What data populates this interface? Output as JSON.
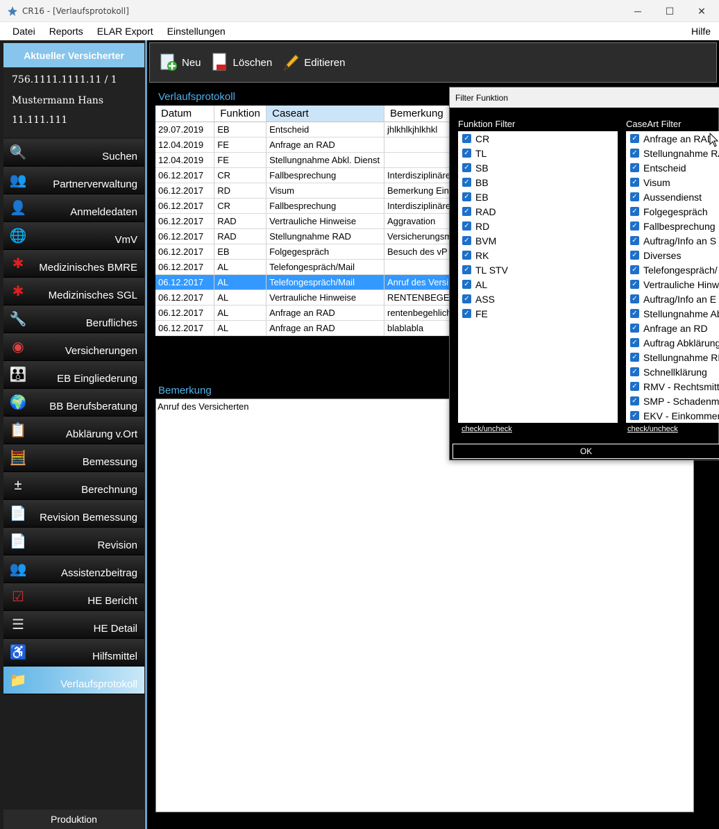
{
  "window": {
    "title": "CR16 - [Verlaufsprotokoll]",
    "minimize_glyph": "─",
    "maximize_glyph": "☐",
    "close_glyph": "✕"
  },
  "menu": {
    "items": [
      "Datei",
      "Reports",
      "ELAR Export",
      "Einstellungen"
    ],
    "help": "Hilfe"
  },
  "insured": {
    "header": "Aktueller Versicherter",
    "number": "756.1111.1111.11 / 1",
    "name": "Mustermann Hans",
    "code": "11.111.111"
  },
  "nav": {
    "items": [
      {
        "label": "Suchen",
        "icon": "search-person-icon"
      },
      {
        "label": "Partnerverwaltung",
        "icon": "people-icon"
      },
      {
        "label": "Anmeldedaten",
        "icon": "user-icon"
      },
      {
        "label": "VmV",
        "icon": "globe-icon"
      },
      {
        "label": "Medizinisches BMRE",
        "icon": "medical-star-icon"
      },
      {
        "label": "Medizinisches SGL",
        "icon": "medical-star-icon"
      },
      {
        "label": "Berufliches",
        "icon": "tools-icon"
      },
      {
        "label": "Versicherungen",
        "icon": "lifebuoy-icon"
      },
      {
        "label": "EB Eingliederung",
        "icon": "group-icon"
      },
      {
        "label": "BB Berufsberatung",
        "icon": "globe-people-icon"
      },
      {
        "label": "Abklärung v.Ort",
        "icon": "clipboard-icon"
      },
      {
        "label": "Bemessung",
        "icon": "calculator-icon"
      },
      {
        "label": "Berechnung",
        "icon": "math-icon"
      },
      {
        "label": "Revision Bemessung",
        "icon": "document-chart-icon"
      },
      {
        "label": "Revision",
        "icon": "document-chart-icon"
      },
      {
        "label": "Assistenzbeitrag",
        "icon": "people-icon"
      },
      {
        "label": "HE Bericht",
        "icon": "report-check-icon"
      },
      {
        "label": "HE Detail",
        "icon": "report-list-icon"
      },
      {
        "label": "Hilfsmittel",
        "icon": "wheelchair-icon"
      },
      {
        "label": "Verlaufsprotokoll",
        "icon": "folder-icon"
      }
    ],
    "active": "Verlaufsprotokoll",
    "footer": "Produktion"
  },
  "toolbar": {
    "new_label": "Neu",
    "delete_label": "Löschen",
    "edit_label": "Editieren"
  },
  "protocol": {
    "title": "Verlaufsprotokoll",
    "columns": [
      "Datum",
      "Funktion",
      "Caseart",
      "Bemerkung"
    ],
    "sorted_column": "Caseart",
    "rows": [
      [
        "29.07.2019",
        "EB",
        "Entscheid",
        "jhlkhlkjhlkhkl"
      ],
      [
        "12.04.2019",
        "FE",
        "Anfrage an RAD",
        ""
      ],
      [
        "12.04.2019",
        "FE",
        "Stellungnahme Abkl. Dienst",
        ""
      ],
      [
        "06.12.2017",
        "CR",
        "Fallbesprechung",
        "Interdisziplinäre"
      ],
      [
        "06.12.2017",
        "RD",
        "Visum",
        "Bemerkung Ein"
      ],
      [
        "06.12.2017",
        "CR",
        "Fallbesprechung",
        "Interdisziplinäre"
      ],
      [
        "06.12.2017",
        "RAD",
        "Vertrauliche Hinweise",
        "Aggravation"
      ],
      [
        "06.12.2017",
        "RAD",
        "Stellungnahme RAD",
        "Versicherungsm"
      ],
      [
        "06.12.2017",
        "EB",
        "Folgegespräch",
        "Besuch des vP"
      ],
      [
        "06.12.2017",
        "AL",
        "Telefongespräch/Mail",
        ""
      ],
      [
        "06.12.2017",
        "AL",
        "Telefongespräch/Mail",
        "Anruf des Versi"
      ],
      [
        "06.12.2017",
        "AL",
        "Vertrauliche Hinweise",
        "RENTENBEGE"
      ],
      [
        "06.12.2017",
        "AL",
        "Anfrage an RAD",
        "rentenbegehlich"
      ],
      [
        "06.12.2017",
        "AL",
        "Anfrage an RAD",
        "blablabla"
      ]
    ],
    "selected_row": 10
  },
  "remark": {
    "title": "Bemerkung",
    "text": "Anruf des Versicherten"
  },
  "filter_dialog": {
    "title": "Filter Funktion",
    "funktion_label": "Funktion Filter",
    "funktion_items": [
      "CR",
      "TL",
      "SB",
      "BB",
      "EB",
      "RAD",
      "RD",
      "BVM",
      "RK",
      "TL STV",
      "AL",
      "ASS",
      "FE"
    ],
    "caseart_label": "CaseArt Filter",
    "caseart_items": [
      "Anfrage an RAD",
      "Stellungnahme RA",
      "Entscheid",
      "Visum",
      "Aussendienst",
      "Folgegespräch",
      "Fallbesprechung",
      "Auftrag/Info an S",
      "Diverses",
      "Telefongespräch/",
      "Vertrauliche Hinwe",
      "Auftrag/Info an E",
      "Stellungnahme Ab",
      "Anfrage an RD",
      "Auftrag Abklärung",
      "Stellungnahme RD",
      "Schnellklärung",
      "RMV - Rechtsmitt",
      "SMP - Schadenmi",
      "EKV - Einkommen"
    ],
    "check_link": "check/uncheck",
    "ok_label": "OK"
  },
  "colors": {
    "accent": "#4fb0ea",
    "selection": "#3399ff",
    "checkbox": "#1d6fc9"
  }
}
